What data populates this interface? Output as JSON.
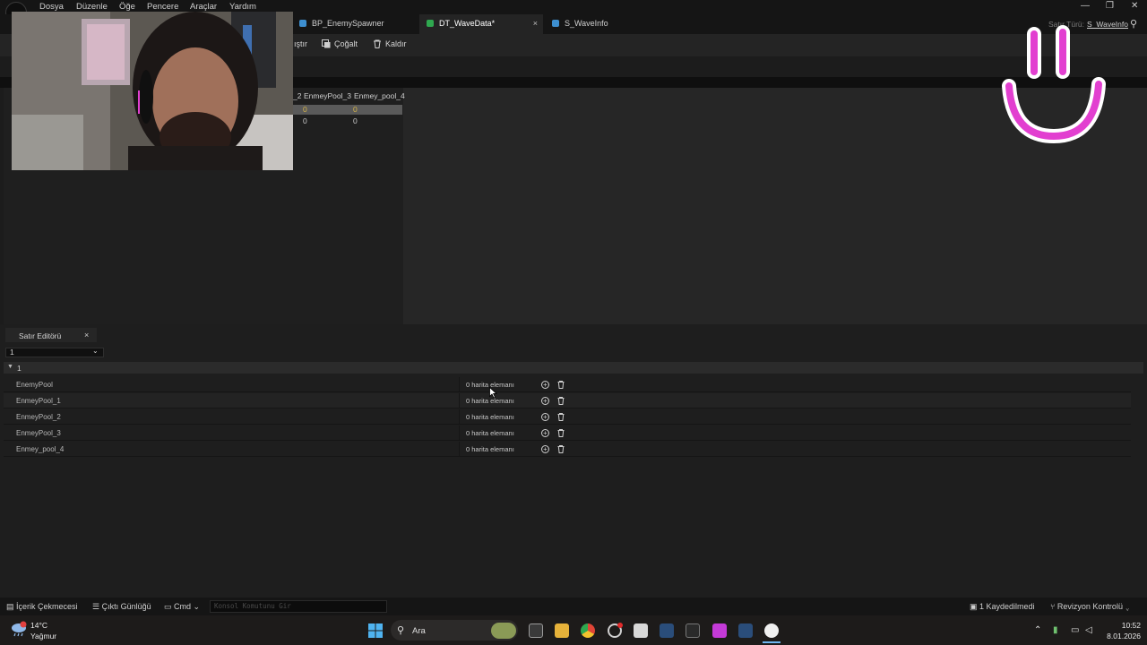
{
  "menu": [
    "Dosya",
    "Düzenle",
    "Öğe",
    "Pencere",
    "Araçlar",
    "Yardım"
  ],
  "tabs": [
    {
      "label": "BP_EnemySpawner",
      "active": false
    },
    {
      "label": "DT_WaveData*",
      "active": true,
      "close": "×"
    },
    {
      "label": "S_WaveInfo",
      "active": false
    }
  ],
  "row_type": {
    "label": "Satır Türü:",
    "value": "S_WaveInfo"
  },
  "toolbar": {
    "partial": "ıştır",
    "duplicate": "Çoğalt",
    "remove": "Kaldır"
  },
  "table": {
    "columns": [
      "_2",
      "EnmeyPool_3",
      "Enmey_pool_4"
    ],
    "rows": [
      {
        "cells": [
          "0",
          "0"
        ],
        "selected": true
      },
      {
        "cells": [
          "0",
          "0"
        ],
        "selected": false
      }
    ]
  },
  "row_editor": {
    "tab_label": "Satır Editörü",
    "tab_close": "×",
    "selected_row": "1",
    "section_label": "1",
    "properties": [
      {
        "name": "EnemyPool",
        "value": "0 harita elemanı"
      },
      {
        "name": "EnmeyPool_1",
        "value": "0 harita elemanı"
      },
      {
        "name": "EnmeyPool_2",
        "value": "0 harita elemanı"
      },
      {
        "name": "EnmeyPool_3",
        "value": "0 harita elemanı"
      },
      {
        "name": "Enmey_pool_4",
        "value": "0 harita elemanı"
      }
    ]
  },
  "statusbar": {
    "content_drawer": "İçerik Çekmecesi",
    "output_log": "Çıktı Günlüğü",
    "cmd": "Cmd",
    "console_placeholder": "Konsol Komutunu Gir",
    "unsaved": "1 Kaydedilmedi",
    "revision": "Revizyon Kontrolü"
  },
  "taskbar": {
    "weather_temp": "14°C",
    "weather_desc": "Yağmur",
    "search": "Ara",
    "time": "10:52",
    "date": "8.01.2026"
  },
  "colors": {
    "accent_pink": "#e23fd0",
    "value_yellow": "#d6b44a",
    "active_tab_icon": "#2fa84f",
    "struct_icon": "#3d8fd0"
  }
}
